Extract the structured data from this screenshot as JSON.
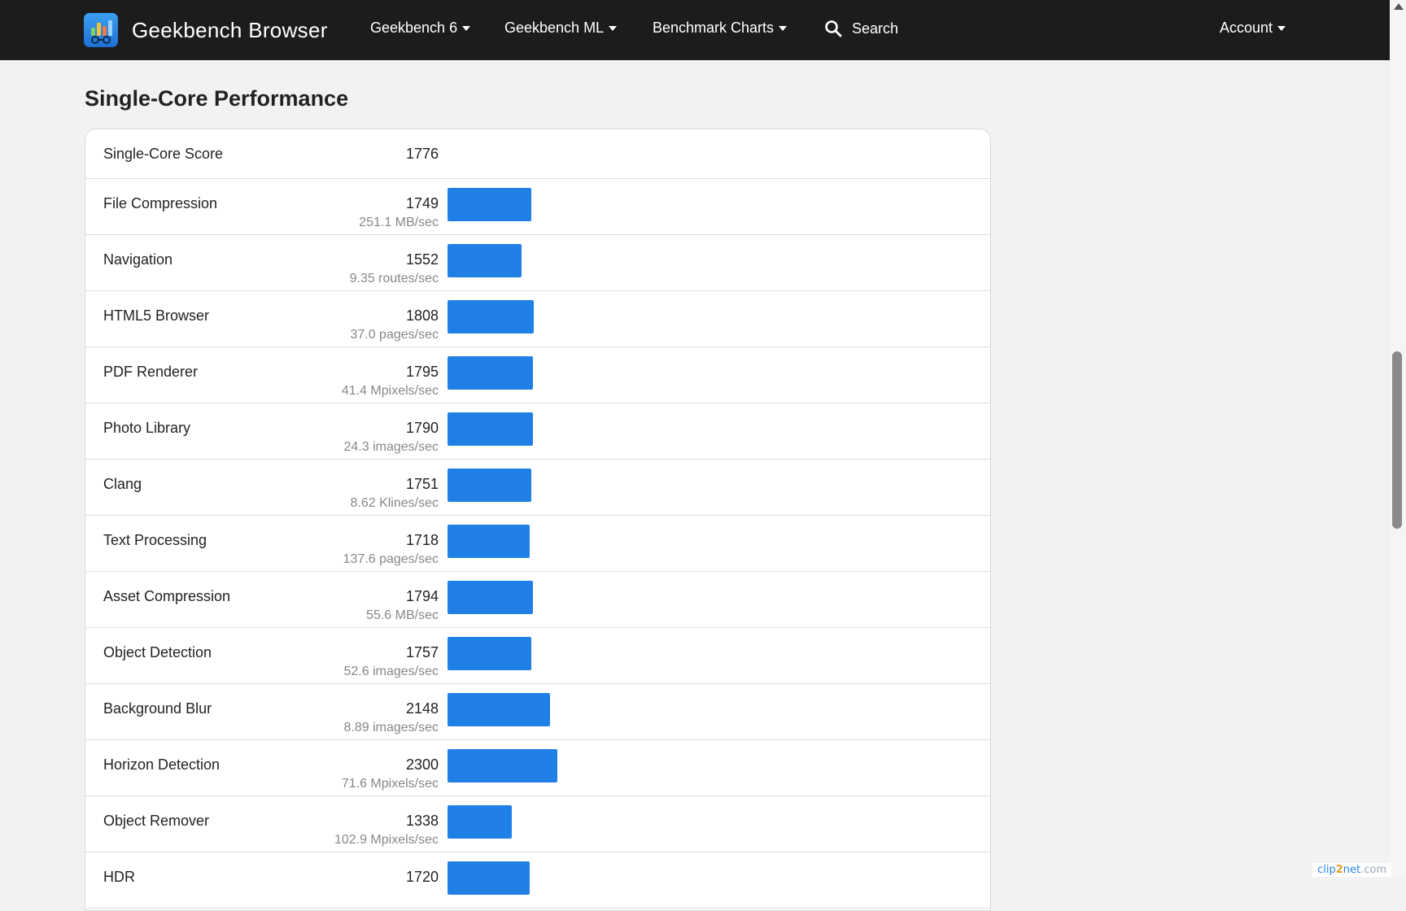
{
  "nav": {
    "brand": "Geekbench Browser",
    "items": [
      {
        "label": "Geekbench 6",
        "dropdown": true
      },
      {
        "label": "Geekbench ML",
        "dropdown": true
      },
      {
        "label": "Benchmark Charts",
        "dropdown": true
      },
      {
        "label": "Search",
        "icon": "search-icon"
      },
      {
        "label": "Account",
        "dropdown": true
      }
    ]
  },
  "section": {
    "title": "Single-Core Performance"
  },
  "chart_data": {
    "type": "bar",
    "title": "Single-Core Performance",
    "total": {
      "label": "Single-Core Score",
      "score": 1776
    },
    "bar_scale_max": 2300,
    "rows": [
      {
        "name": "File Compression",
        "score": 1749,
        "rate": "251.1 MB/sec"
      },
      {
        "name": "Navigation",
        "score": 1552,
        "rate": "9.35 routes/sec"
      },
      {
        "name": "HTML5 Browser",
        "score": 1808,
        "rate": "37.0 pages/sec"
      },
      {
        "name": "PDF Renderer",
        "score": 1795,
        "rate": "41.4 Mpixels/sec"
      },
      {
        "name": "Photo Library",
        "score": 1790,
        "rate": "24.3 images/sec"
      },
      {
        "name": "Clang",
        "score": 1751,
        "rate": "8.62 Klines/sec"
      },
      {
        "name": "Text Processing",
        "score": 1718,
        "rate": "137.6 pages/sec"
      },
      {
        "name": "Asset Compression",
        "score": 1794,
        "rate": "55.6 MB/sec"
      },
      {
        "name": "Object Detection",
        "score": 1757,
        "rate": "52.6 images/sec"
      },
      {
        "name": "Background Blur",
        "score": 2148,
        "rate": "8.89 images/sec"
      },
      {
        "name": "Horizon Detection",
        "score": 2300,
        "rate": "71.6 Mpixels/sec"
      },
      {
        "name": "Object Remover",
        "score": 1338,
        "rate": "102.9 Mpixels/sec"
      },
      {
        "name": "HDR",
        "score": 1720,
        "rate": ""
      }
    ]
  },
  "watermark": {
    "a": "clip",
    "b": "2",
    "c": "net",
    "d": ".com"
  },
  "colors": {
    "bar": "#2080e6",
    "navbar": "#1c1c1c",
    "page_bg": "#f2f2f2"
  }
}
